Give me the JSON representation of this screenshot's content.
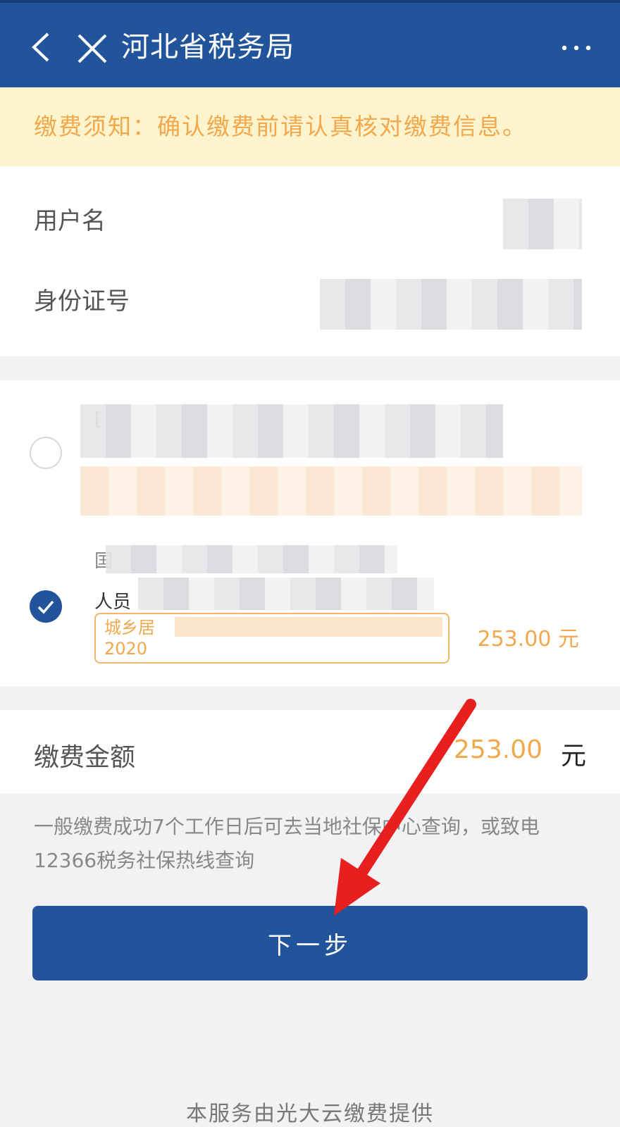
{
  "header": {
    "title": "河北省税务局"
  },
  "notice": {
    "text": "缴费须知：确认缴费前请认真核对缴费信息。"
  },
  "user": {
    "username_label": "用户名",
    "id_label": "身份证号"
  },
  "items": [
    {
      "prefix": "[",
      "selected": false
    },
    {
      "prefix": "国",
      "sub": "人员",
      "tag_line1": "城乡居",
      "tag_line2": "2020",
      "amount": "253.00 元",
      "selected": true
    }
  ],
  "total": {
    "label": "缴费金额",
    "amount": "253.00",
    "unit": "元"
  },
  "hint": "一般缴费成功7个工作日后可去当地社保中心查询，或致电12366税务社保热线查询",
  "next_button": "下一步",
  "footer": "本服务由光大云缴费提供",
  "colors": {
    "primary": "#22549c",
    "accent": "#f2a84d",
    "notice_bg": "#fdf3cd",
    "arrow": "#e81f1f"
  }
}
